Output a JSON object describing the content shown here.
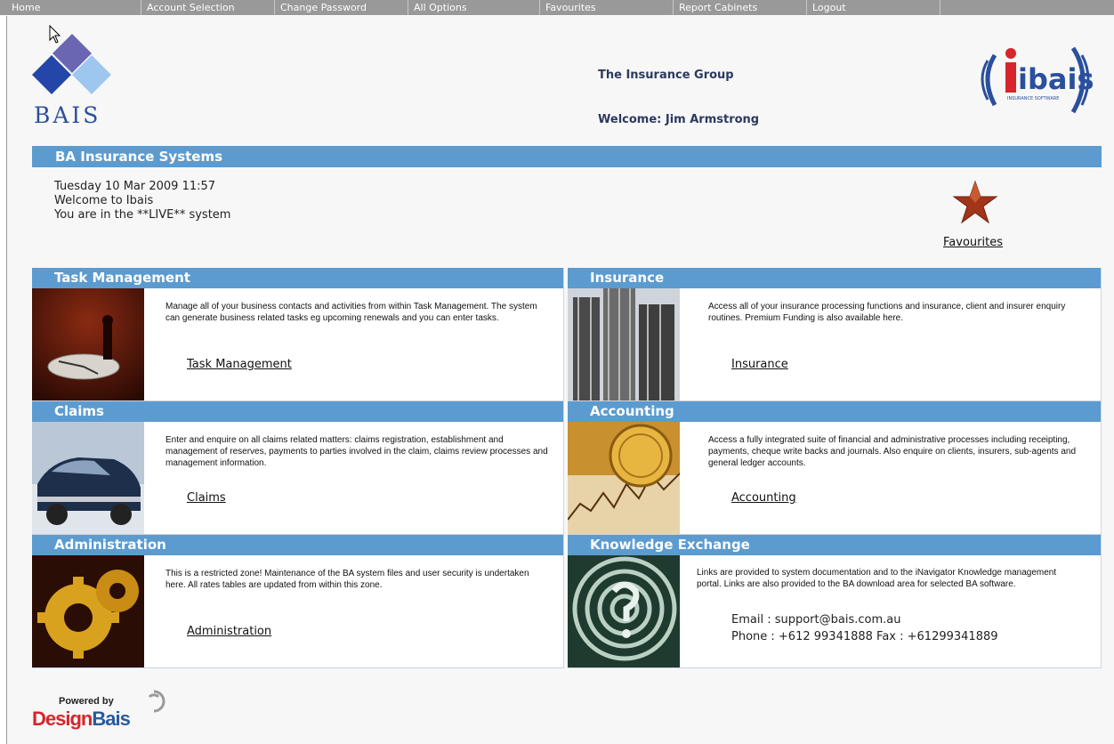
{
  "nav": {
    "items": [
      "Home",
      "Account Selection",
      "Change Password",
      "All Options",
      "Favourites",
      "Report Cabinets",
      "Logout"
    ]
  },
  "header": {
    "logo_text": "BAIS",
    "company": "The Insurance Group",
    "welcome": "Welcome:  Jim Armstrong",
    "right_logo_text": "ibais",
    "right_logo_subtext": "INSURANCE SOFTWARE"
  },
  "main": {
    "title": "BA Insurance Systems",
    "info_lines": [
      "Tuesday 10 Mar 2009 11:57",
      "Welcome to Ibais",
      "You are in the **LIVE** system"
    ],
    "favourites_label": "Favourites"
  },
  "sections": {
    "task": {
      "title": "Task Management",
      "desc": "Manage all of your business contacts and activities from within Task Management.  The system can generate business related tasks eg upcoming renewals and you can enter tasks.",
      "link": "Task Management"
    },
    "insurance": {
      "title": "Insurance",
      "desc": "Access all of your insurance processing functions and insurance, client and insurer enquiry routines.  Premium Funding is also available here.",
      "link": "Insurance"
    },
    "claims": {
      "title": "Claims",
      "desc": "Enter and enquire on all claims related matters: claims registration, establishment and management of reserves, payments to parties involved in the claim, claims review processes and management information.",
      "link": "Claims"
    },
    "accounting": {
      "title": "Accounting",
      "desc": "Access a fully integrated suite of financial and administrative processes including receipting, payments, cheque write backs and journals. Also enquire on clients, insurers, sub-agents and general ledger accounts.",
      "link": "Accounting"
    },
    "administration": {
      "title": "Administration",
      "desc": "This is a restricted zone! Maintenance of the BA system files and user security is undertaken here. All rates tables are updated from within this zone.",
      "link": "Administration"
    },
    "knowledge": {
      "title": "Knowledge Exchange",
      "desc": "Links are provided to system documentation and to the iNavigator Knowledge management portal. Links are also provided to the BA download area for selected BA software.",
      "email": "Email  : support@bais.com.au",
      "phone": "Phone : +612 99341888   Fax : +61299341889"
    }
  },
  "footer": {
    "powered_by": "Powered by",
    "brand_part1": "Design",
    "brand_part2": "Bais"
  },
  "colors": {
    "nav_bg": "#999999",
    "accent_blue": "#5b9bd0",
    "brand_dark": "#2b3a5e"
  }
}
